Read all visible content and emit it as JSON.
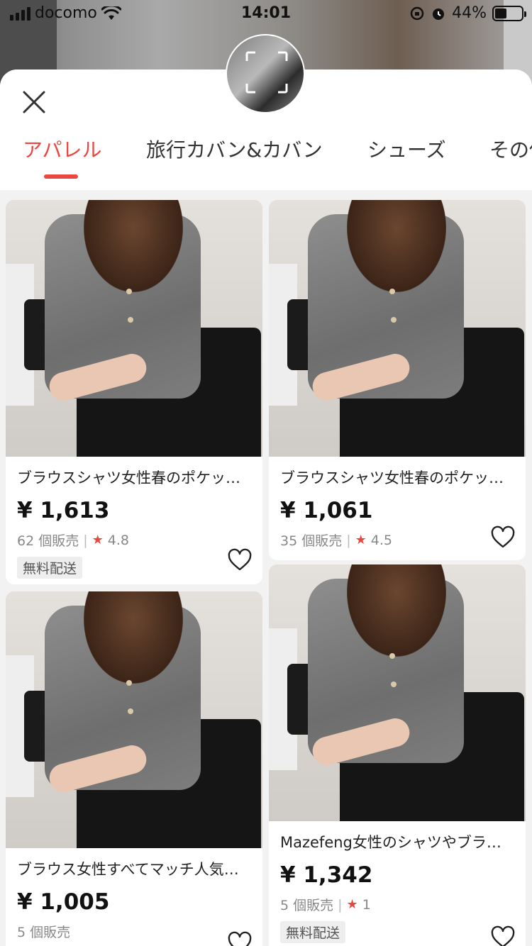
{
  "status_bar": {
    "carrier": "docomo",
    "time": "14:01",
    "battery": "44%"
  },
  "tabs": [
    {
      "label": "アパレル",
      "active": true
    },
    {
      "label": "旅行カバン&カバン",
      "active": false
    },
    {
      "label": "シューズ",
      "active": false
    },
    {
      "label": "その他",
      "active": false
    }
  ],
  "products": [
    {
      "title": "ブラウスシャツ女性春のポケット付きシャツ",
      "price": "¥ 1,613",
      "sold": "62 個販売",
      "rating": "4.8",
      "badge": "無料配送"
    },
    {
      "title": "ブラウスシャツ女性春のポケット付きシャツ",
      "price": "¥ 1,061",
      "sold": "35 個販売",
      "rating": "4.5",
      "badge": ""
    },
    {
      "title": "ブラウス女性すべてマッチ人気シャツ",
      "price": "¥ 1,005",
      "sold": "5 個販売",
      "rating": "",
      "badge": ""
    },
    {
      "title": "Mazefeng女性のシャツやブラウス",
      "price": "¥ 1,342",
      "sold": "5 個販売",
      "rating": "1",
      "badge": "無料配送"
    }
  ],
  "colors": {
    "accent": "#e8483f",
    "text": "#222222",
    "muted": "#888888"
  }
}
